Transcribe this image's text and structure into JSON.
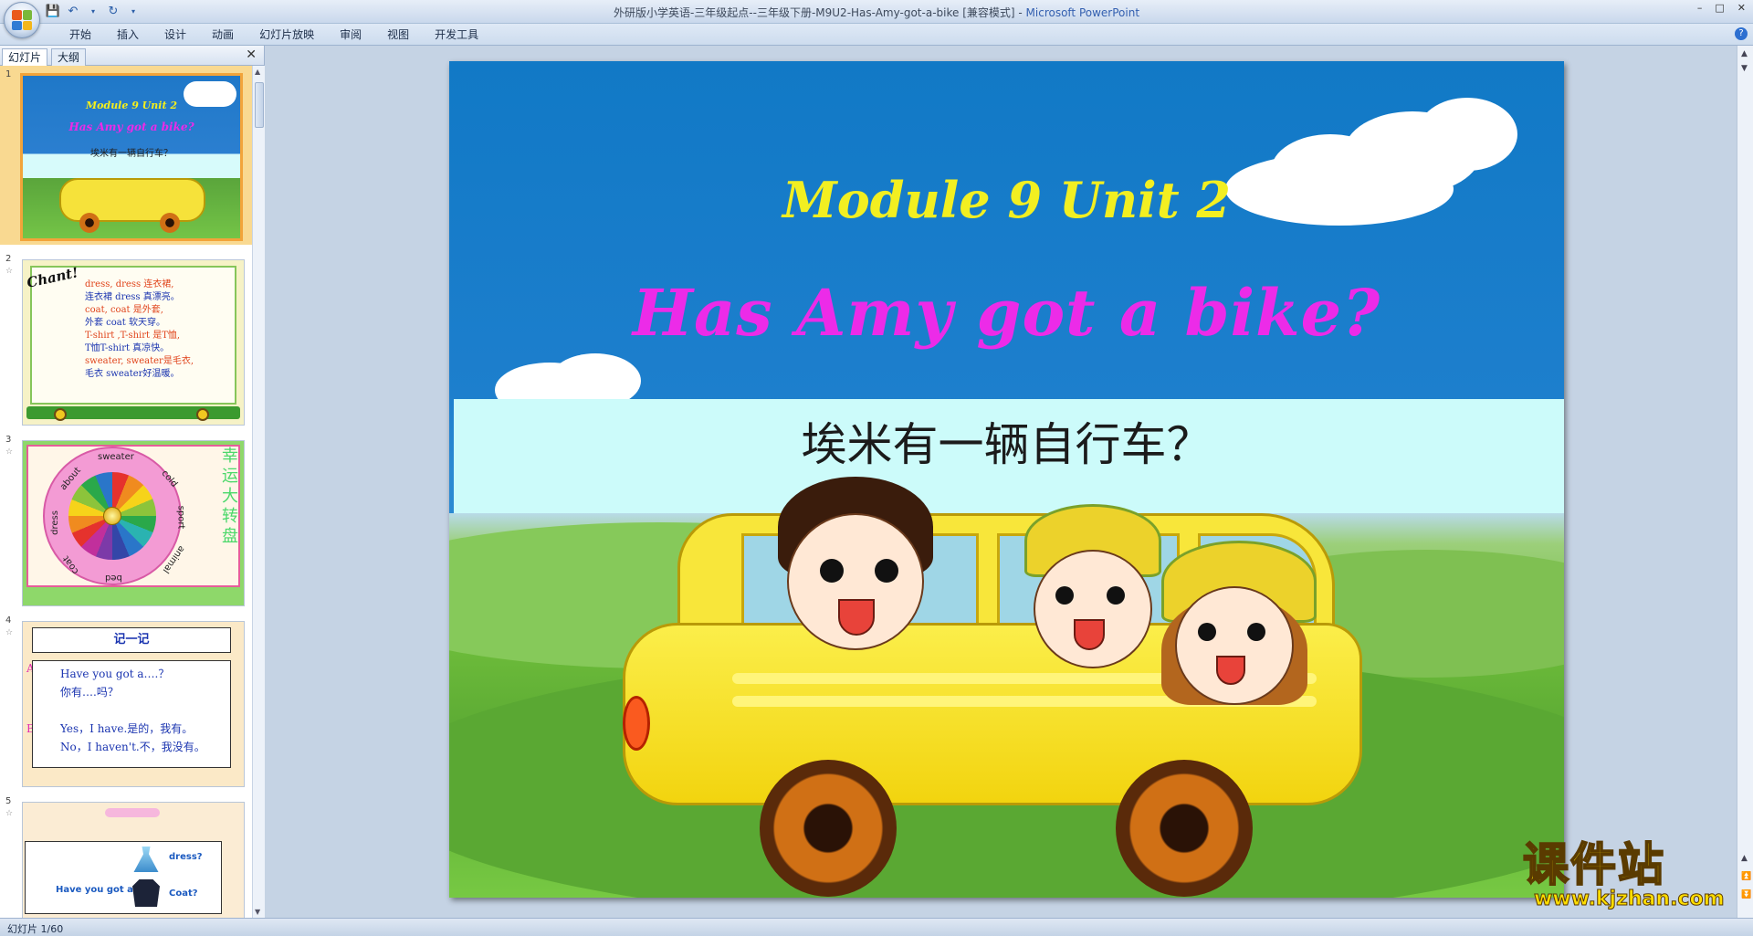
{
  "window": {
    "title_doc": "外研版小学英语-三年级起点--三年级下册-M9U2-Has-Amy-got-a-bike [兼容模式]",
    "title_sep": " - ",
    "title_app": "Microsoft PowerPoint",
    "controls": [
      "–",
      "□",
      "✕"
    ]
  },
  "ribbon": {
    "tabs": [
      "开始",
      "插入",
      "设计",
      "动画",
      "幻灯片放映",
      "审阅",
      "视图",
      "开发工具"
    ],
    "help": "?"
  },
  "panel": {
    "tab_slides": "幻灯片",
    "tab_outline": "大纲",
    "close": "✕"
  },
  "thumbnails": {
    "s1": {
      "num": "1",
      "title": "Module 9 Unit 2",
      "subtitle": "Has Amy  got a bike?",
      "cn": "埃米有一辆自行车？"
    },
    "s2": {
      "num": "2",
      "chant": "Chant!",
      "lines": [
        "dress, dress 连衣裙,",
        "连衣裙 dress 真漂亮。",
        "coat, coat 是外套,",
        "外套 coat 软天穿。",
        "T-shirt ,T-shirt 是T恤,",
        "T恤T-shirt 真凉快。",
        "sweater, sweater是毛衣,",
        "毛衣 sweater好温暖。"
      ]
    },
    "s3": {
      "num": "3",
      "words": [
        "sweater",
        "cold",
        "sport",
        "animal",
        "bed",
        "coat",
        "dress",
        "about"
      ],
      "vertical": "幸运大转盘"
    },
    "s4": {
      "num": "4",
      "heading": "记一记",
      "a_label": "A：",
      "b_label": "B：",
      "lines": [
        "Have you got a….？",
        "你有….吗？",
        "",
        "Yes，I have.是的，我有。",
        "No，I haven't.不，我没有。"
      ]
    },
    "s5": {
      "num": "5",
      "prompt": "Have  you got a",
      "opt1": "dress?",
      "opt2": "Coat?"
    }
  },
  "slide": {
    "module": "Module 9 Unit 2",
    "question": "Has Amy  got a bike?",
    "chinese": "埃米有一辆自行车？"
  },
  "watermark": {
    "cn": "课件站",
    "url": "www.kjzhan.com"
  },
  "status": {
    "text": "幻灯片 1/60"
  },
  "colors": {
    "sky": "#1179c6",
    "title_yellow": "#f2ef21",
    "title_magenta": "#ec2be8",
    "band": "#ccfbfa",
    "grass": "#5aa833",
    "car_yellow": "#f8e63a"
  }
}
